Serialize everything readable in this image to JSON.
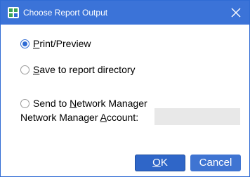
{
  "window": {
    "title": "Choose Report Output",
    "app_icon": "report-app-icon",
    "close_icon": "close-icon",
    "accent_color": "#3b73d8"
  },
  "options": [
    {
      "label_pre": "",
      "label_key": "P",
      "label_post": "rint/Preview",
      "checked": true
    },
    {
      "label_pre": "",
      "label_key": "S",
      "label_post": "ave to report directory",
      "checked": false
    },
    {
      "label_pre": "Send to ",
      "label_key": "N",
      "label_post": "etwork Manager",
      "checked": false
    }
  ],
  "account": {
    "label_pre": "Network Manager ",
    "label_key": "A",
    "label_post": "ccount:",
    "value": "",
    "placeholder": ""
  },
  "buttons": {
    "ok_key": "O",
    "ok_post": "K",
    "cancel_label": "Cancel"
  }
}
